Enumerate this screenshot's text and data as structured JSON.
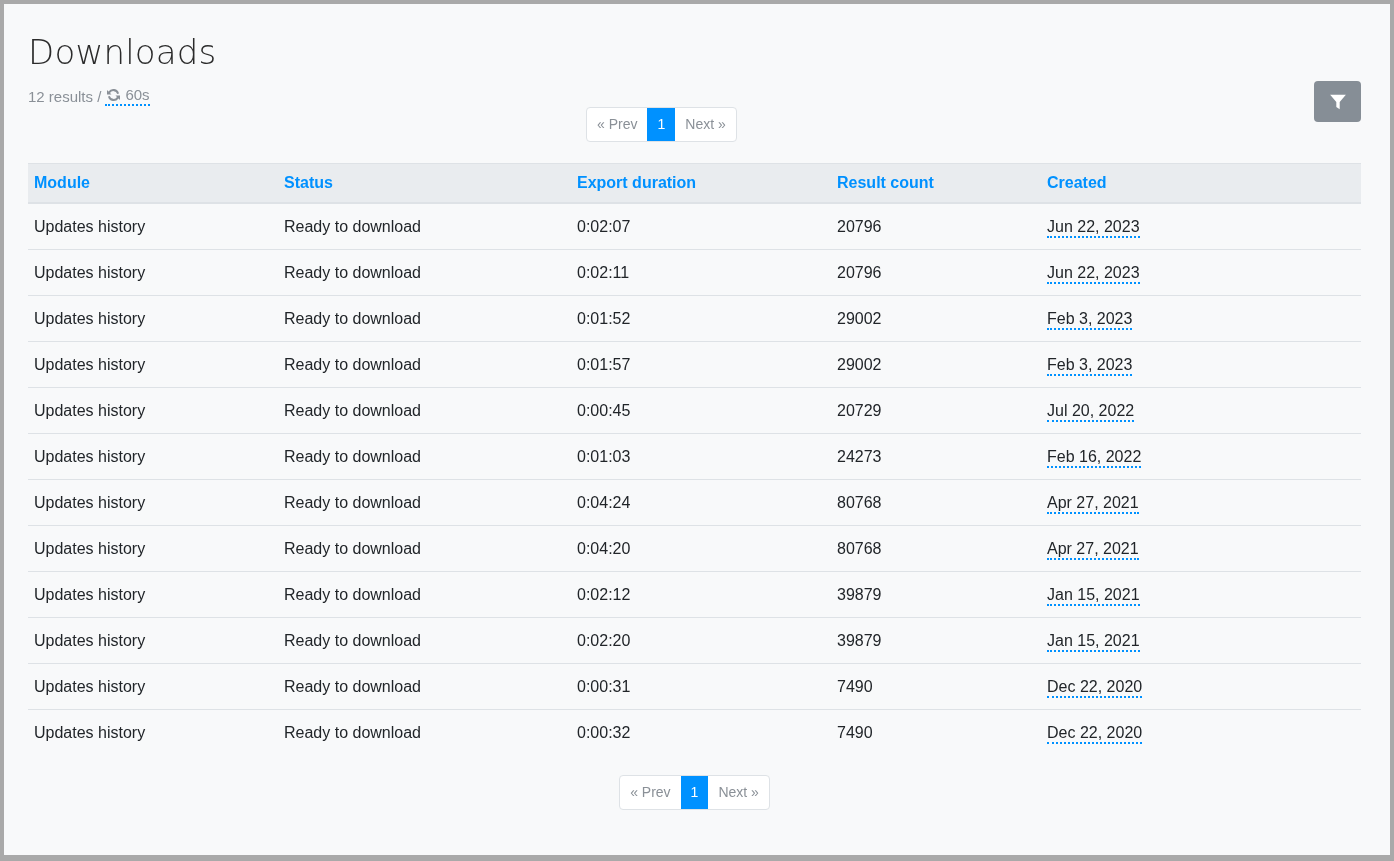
{
  "title": "Downloads",
  "summary": {
    "results": "12 results /",
    "refresh": "60s"
  },
  "pager_top": [
    {
      "label": "« Prev",
      "selected": false,
      "disabled": true
    },
    {
      "label": "1",
      "selected": true,
      "disabled": false
    },
    {
      "label": "Next »",
      "selected": false,
      "disabled": true
    }
  ],
  "table": {
    "columns": [
      "Module",
      "Status",
      "Export duration",
      "Result count",
      "Created"
    ],
    "rows": [
      [
        "Updates history",
        "Ready to download",
        "0:02:07",
        "20796",
        "Jun 22, 2023"
      ],
      [
        "Updates history",
        "Ready to download",
        "0:02:11",
        "20796",
        "Jun 22, 2023"
      ],
      [
        "Updates history",
        "Ready to download",
        "0:01:52",
        "29002",
        "Feb 3, 2023"
      ],
      [
        "Updates history",
        "Ready to download",
        "0:01:57",
        "29002",
        "Feb 3, 2023"
      ],
      [
        "Updates history",
        "Ready to download",
        "0:00:45",
        "20729",
        "Jul 20, 2022"
      ],
      [
        "Updates history",
        "Ready to download",
        "0:01:03",
        "24273",
        "Feb 16, 2022"
      ],
      [
        "Updates history",
        "Ready to download",
        "0:04:24",
        "80768",
        "Apr 27, 2021"
      ],
      [
        "Updates history",
        "Ready to download",
        "0:04:20",
        "80768",
        "Apr 27, 2021"
      ],
      [
        "Updates history",
        "Ready to download",
        "0:02:12",
        "39879",
        "Jan 15, 2021"
      ],
      [
        "Updates history",
        "Ready to download",
        "0:02:20",
        "39879",
        "Jan 15, 2021"
      ],
      [
        "Updates history",
        "Ready to download",
        "0:00:31",
        "7490",
        "Dec 22, 2020"
      ],
      [
        "Updates history",
        "Ready to download",
        "0:00:32",
        "7490",
        "Dec 22, 2020"
      ]
    ]
  },
  "pager_bottom": [
    {
      "label": "« Prev",
      "selected": false,
      "disabled": true
    },
    {
      "label": "1",
      "selected": true,
      "disabled": false
    },
    {
      "label": "Next »",
      "selected": false,
      "disabled": true
    }
  ]
}
